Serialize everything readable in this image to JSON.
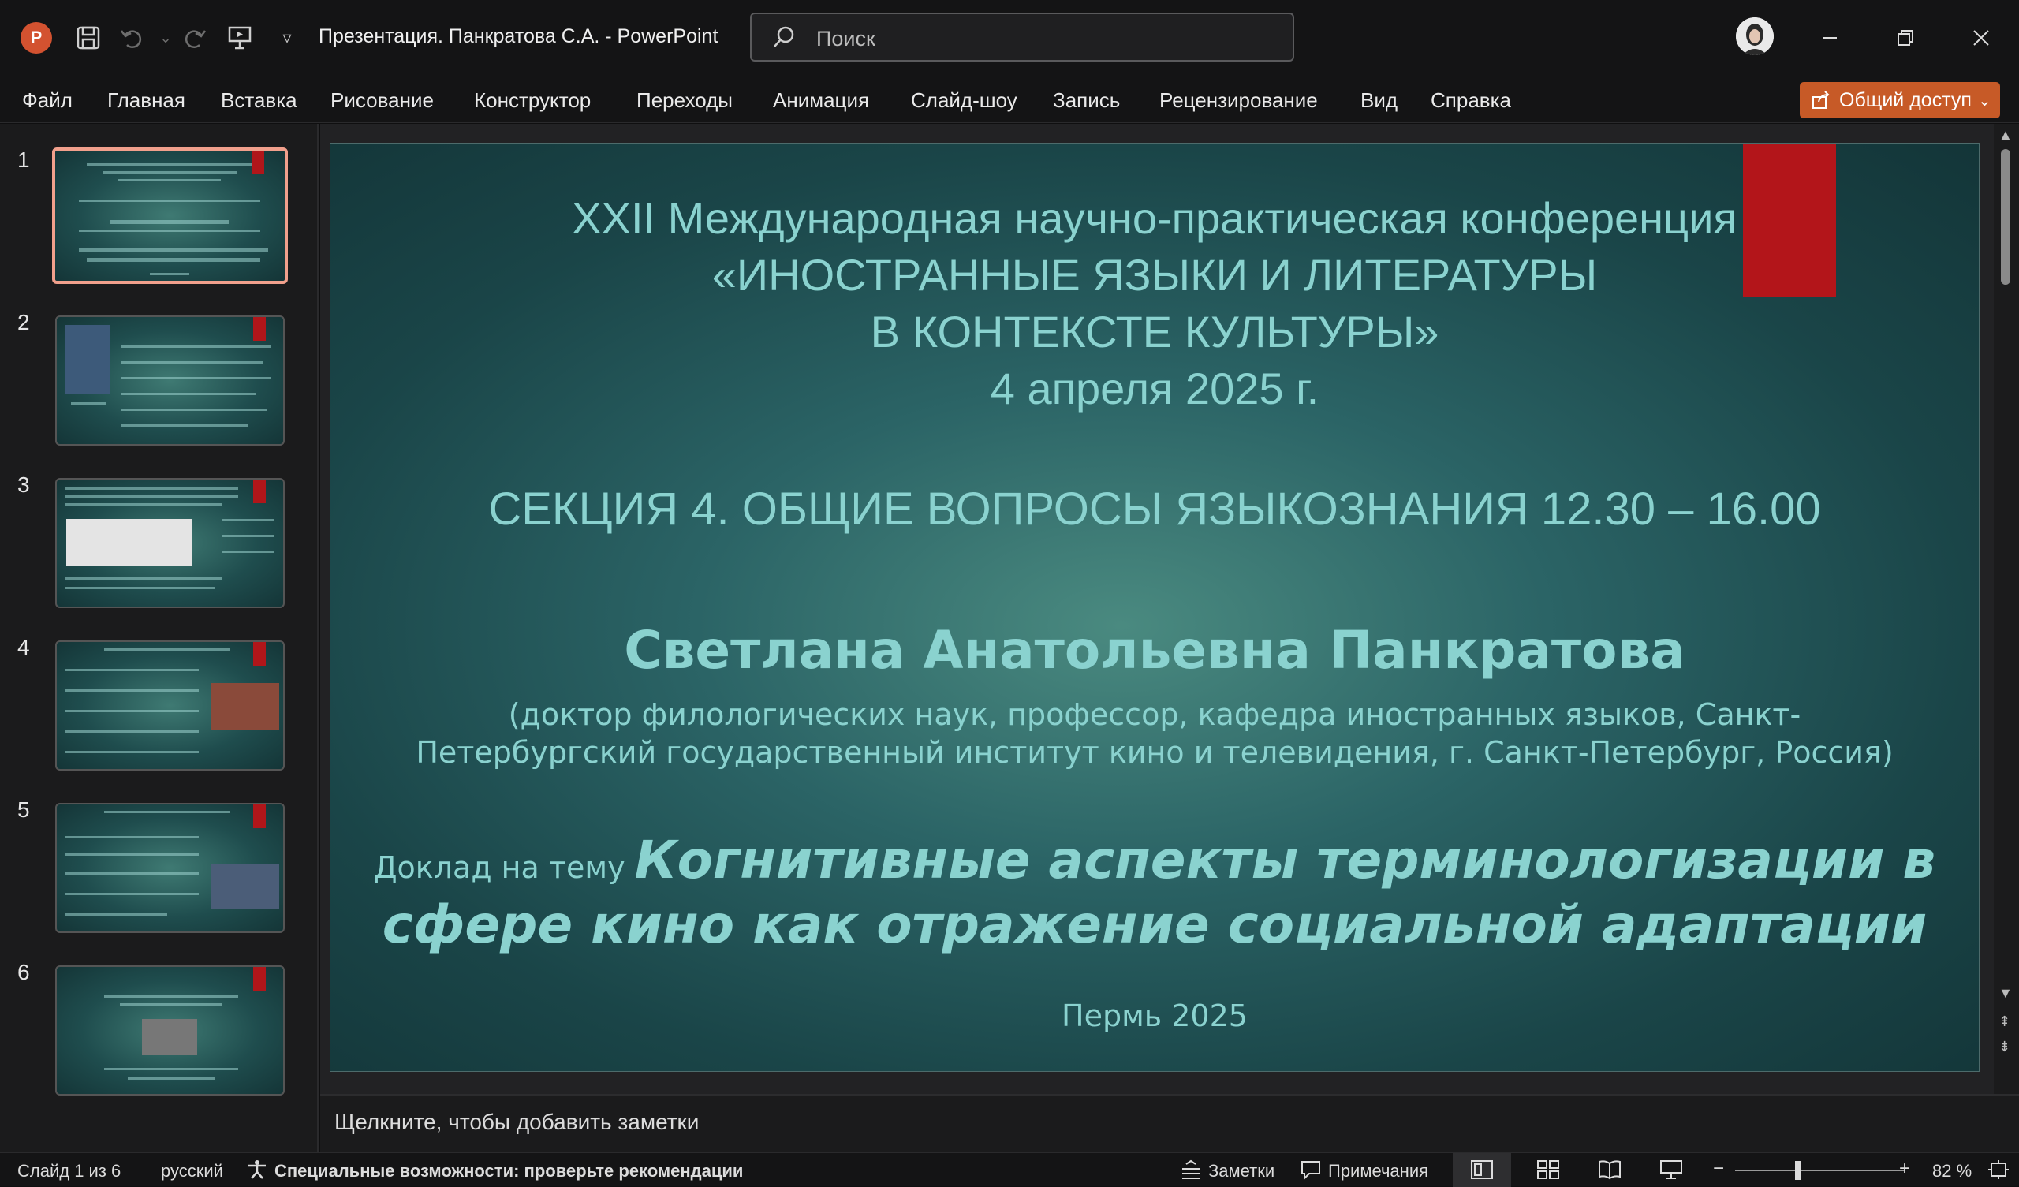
{
  "titlebar": {
    "app_logo": "P",
    "doc_title": "Презентация. Панкратова С.А.  -  PowerPoint",
    "search_placeholder": "Поиск",
    "icons": [
      "save-icon",
      "undo-icon",
      "redo-icon",
      "present-from-start-icon",
      "customize-qat-icon"
    ]
  },
  "ribbon": {
    "tabs": [
      "Файл",
      "Главная",
      "Вставка",
      "Рисование",
      "Конструктор",
      "Переходы",
      "Анимация",
      "Слайд-шоу",
      "Запись",
      "Рецензирование",
      "Вид",
      "Справка"
    ],
    "share_label": "Общий доступ"
  },
  "thumbnails": {
    "numbers": [
      "1",
      "2",
      "3",
      "4",
      "5",
      "6"
    ],
    "selected": 1
  },
  "slide": {
    "conf_line1": "XXII Международная научно-практическая конференция",
    "conf_line2": "«ИНОСТРАННЫЕ ЯЗЫКИ И ЛИТЕРАТУРЫ",
    "conf_line3": "В КОНТЕКСТЕ КУЛЬТУРЫ»",
    "date": "4 апреля 2025 г.",
    "section": "СЕКЦИЯ 4. ОБЩИЕ ВОПРОСЫ ЯЗЫКОЗНАНИЯ 12.30 – 16.00",
    "author": "Светлана Анатольевна Панкратова",
    "affiliation_line1": "(доктор филологических наук, профессор, кафедра иностранных языков, Санкт-",
    "affiliation_line2": "Петербургский государственный институт кино и телевидения, г. Санкт-Петербург, Россия)",
    "topic_lead": "Доклад на тему ",
    "topic_line1": "Когнитивные аспекты терминологизации в",
    "topic_line2": "сфере кино как отражение социальной адаптации",
    "city_year": "Пермь 2025",
    "colors": {
      "text": "#8ad2cf",
      "accent_band": "#b3151a",
      "background": "#2b6466"
    }
  },
  "notes": {
    "placeholder": "Щелкните, чтобы добавить заметки"
  },
  "statusbar": {
    "slide_counter": "Слайд 1 из 6",
    "language": "русский",
    "accessibility": "Специальные возможности: проверьте рекомендации",
    "notes_label": "Заметки",
    "comments_label": "Примечания",
    "zoom_minus": "−",
    "zoom_plus": "+",
    "zoom_value": "82 %",
    "zoom_level_percent": 82
  }
}
